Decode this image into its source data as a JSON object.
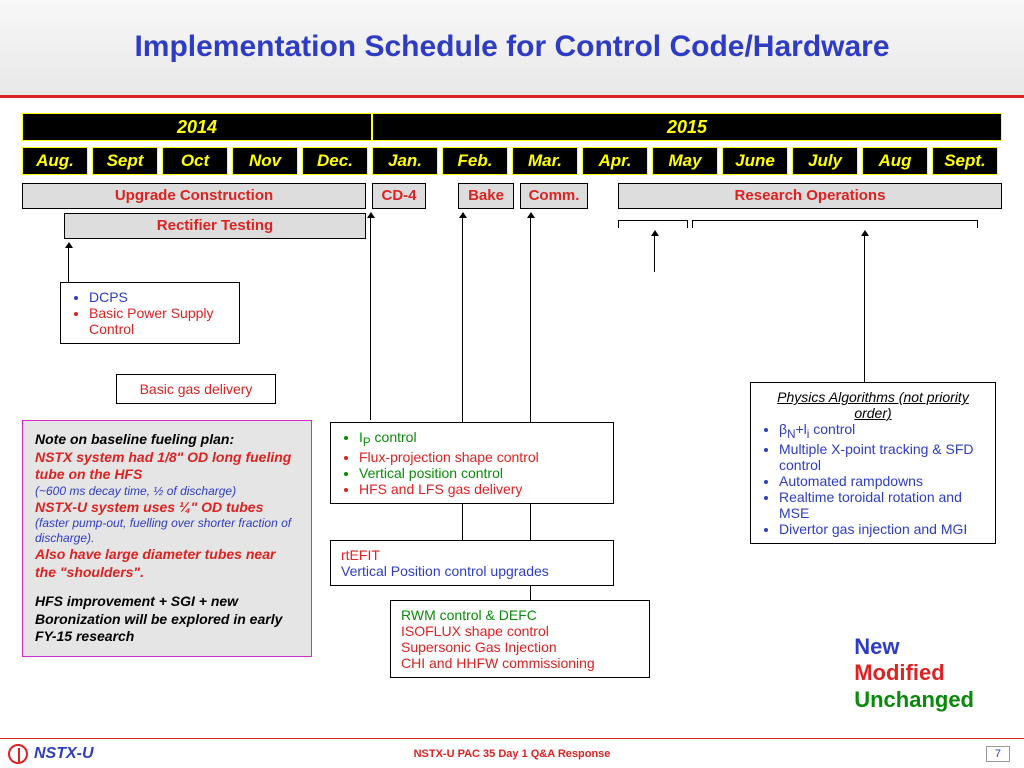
{
  "title": "Implementation Schedule for Control Code/Hardware",
  "years": {
    "a": "2014",
    "b": "2015"
  },
  "months": [
    "Aug.",
    "Sept",
    "Oct",
    "Nov",
    "Dec.",
    "Jan.",
    "Feb.",
    "Mar.",
    "Apr.",
    "May",
    "June",
    "July",
    "Aug",
    "Sept."
  ],
  "phases": {
    "upgrade": "Upgrade Construction",
    "cd4": "CD-4",
    "bake": "Bake",
    "comm": "Comm.",
    "research": "Research Operations",
    "rectifier": "Rectifier Testing"
  },
  "box_dcps": {
    "a": "DCPS",
    "b": "Basic Power Supply Control"
  },
  "box_gas": "Basic gas delivery",
  "box_ip": {
    "a": "I",
    "asub": "P",
    "atail": " control",
    "b": "Flux-projection shape control",
    "c": "Vertical position control",
    "d": "HFS and LFS gas delivery"
  },
  "box_rtefit": {
    "a": "rtEFIT",
    "b": "Vertical Position control upgrades"
  },
  "box_rwm": {
    "a": "RWM control & DEFC",
    "b": "ISOFLUX shape control",
    "c": "Supersonic Gas Injection",
    "d": "CHI and HHFW commissioning"
  },
  "box_phys": {
    "title": "Physics Algorithms (not priority order)",
    "i0a": "β",
    "i0b": "N",
    "i0c": "+l",
    "i0d": "i",
    "i0e": " control",
    "i1": "Multiple X-point tracking & SFD control",
    "i2": "Automated rampdowns",
    "i3": "Realtime toroidal rotation and MSE",
    "i4": "Divertor gas injection and MGI"
  },
  "note": {
    "t": "Note on baseline fueling plan:",
    "l1": "NSTX system had 1/8\" OD long fueling tube on the HFS",
    "l2": "(~600 ms decay time, ½ of discharge)",
    "l3": "NSTX-U system uses ¼\" OD tubes",
    "l4": "(faster pump-out, fuelling over shorter fraction of discharge).",
    "l5": "Also have large diameter tubes near the \"shoulders\".",
    "l6": "HFS improvement + SGI + new Boronization will be explored in early FY-15 research"
  },
  "legend": {
    "new": "New",
    "mod": "Modified",
    "unch": "Unchanged"
  },
  "footer": {
    "brand": "NSTX-U",
    "center": "NSTX-U PAC 35 Day 1 Q&A Response",
    "page": "7"
  }
}
